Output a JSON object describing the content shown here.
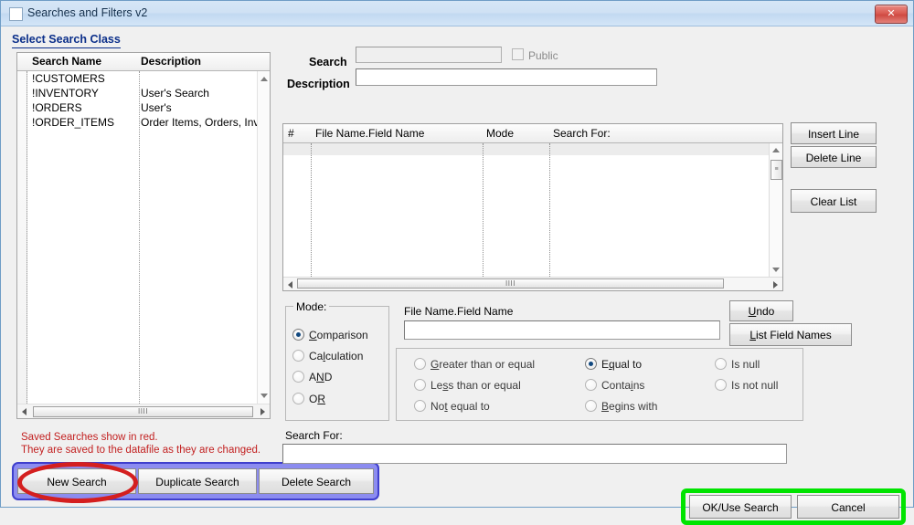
{
  "window": {
    "title": "Searches and Filters v2",
    "close_label": "✕",
    "icon": "window-icon"
  },
  "left_pane": {
    "section_label": "Select Search Class",
    "columns": [
      "Search Name",
      "Description"
    ],
    "rows": [
      {
        "name": "!CUSTOMERS",
        "description": ""
      },
      {
        "name": "!INVENTORY",
        "description": "User's Search"
      },
      {
        "name": "!ORDERS",
        "description": "User's"
      },
      {
        "name": "!ORDER_ITEMS",
        "description": "Order Items, Orders, Inv..."
      }
    ],
    "note_line1": "Saved Searches show in red.",
    "note_line2": "They are saved to the datafile as they are changed."
  },
  "bottom_left_buttons": {
    "new_search": "New Search",
    "duplicate_search": "Duplicate Search",
    "delete_search": "Delete Search"
  },
  "top_fields": {
    "search_label": "Search",
    "search_value": "",
    "search_enabled": false,
    "public_label": "Public",
    "public_checked": false,
    "description_label": "Description",
    "description_value": ""
  },
  "grid": {
    "columns": [
      "#",
      "File Name.Field Name",
      "Mode",
      "Search For:"
    ],
    "rows": []
  },
  "grid_buttons": {
    "insert_line": "Insert Line",
    "delete_line": "Delete Line",
    "clear_list": "Clear List"
  },
  "mode_group": {
    "title": "Mode:",
    "options": [
      {
        "label": "Comparison",
        "accel": "C",
        "selected": true
      },
      {
        "label": "Calculation",
        "accel": "l",
        "selected": false
      },
      {
        "label": "AND",
        "accel": "N",
        "selected": false
      },
      {
        "label": "OR",
        "accel": "R",
        "selected": false
      }
    ]
  },
  "field_selector": {
    "label": "File Name.Field Name",
    "value": "",
    "undo_label": "Undo",
    "list_field_names_label": "List Field Names"
  },
  "operators": {
    "column1": [
      {
        "label": "Greater than or equal",
        "accel": "G",
        "selected": false
      },
      {
        "label": "Less than or equal",
        "accel": "s",
        "selected": false
      },
      {
        "label": "Not equal to",
        "accel": "t",
        "selected": false
      }
    ],
    "column2": [
      {
        "label": "Equal to",
        "accel": "q",
        "selected": true
      },
      {
        "label": "Contains",
        "accel": "i",
        "selected": false
      },
      {
        "label": "Begins with",
        "accel": "B",
        "selected": false
      }
    ],
    "column3": [
      {
        "label": "Is null",
        "accel": "",
        "selected": false
      },
      {
        "label": "Is not null",
        "accel": "",
        "selected": false
      }
    ]
  },
  "search_for": {
    "label": "Search For:",
    "value": ""
  },
  "dialog_buttons": {
    "ok": "OK/Use Search",
    "cancel": "Cancel"
  },
  "annotations": {
    "red_ellipse_target": "New Search",
    "blue_box_target": "bottom-left button row",
    "green_box_target": "OK / Cancel buttons",
    "red_color": "#d41f1f",
    "blue_color": "#8c8cf0",
    "green_color": "#00e400"
  }
}
